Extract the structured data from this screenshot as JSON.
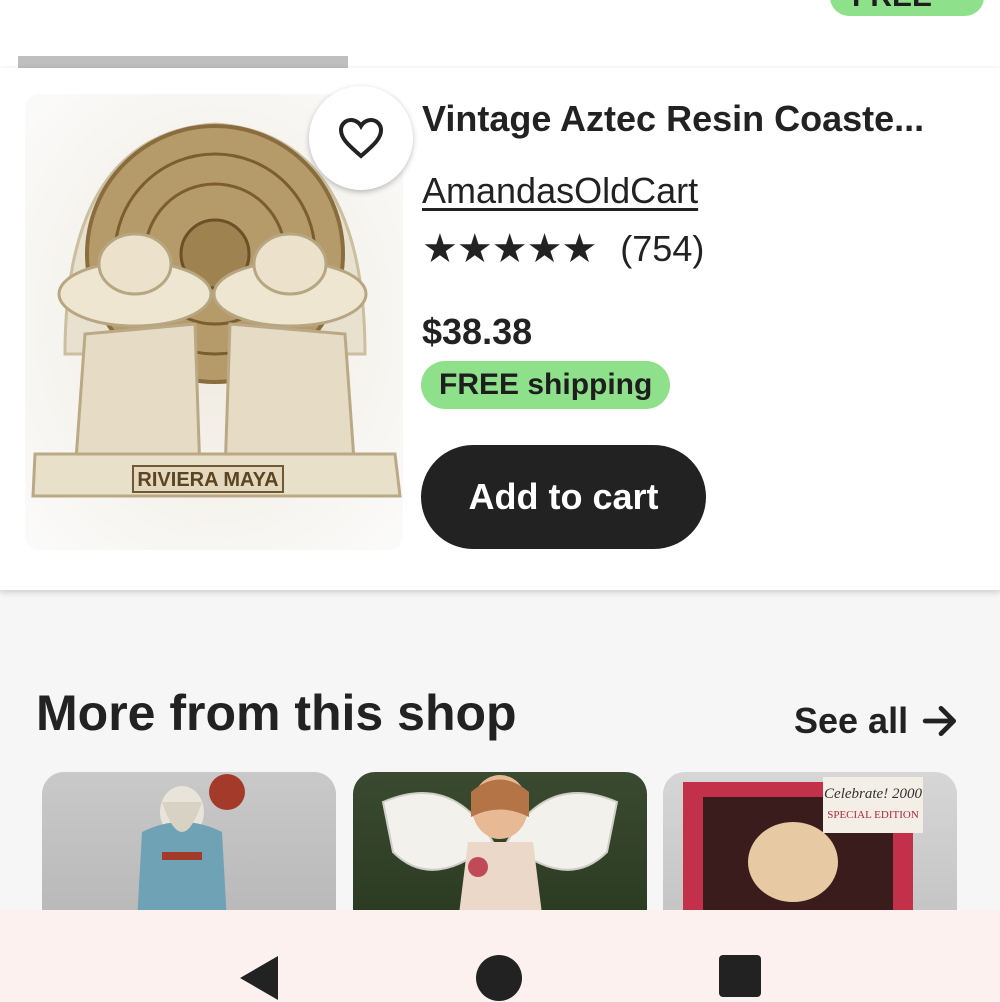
{
  "top": {
    "free_chip": "FREE shi"
  },
  "product": {
    "title": "Vintage Aztec Resin Coaste...",
    "shop": "AmandasOldCart",
    "stars": "★★★★★",
    "review_count": "(754)",
    "rating": 5,
    "price": "$38.38",
    "shipping": "FREE shipping",
    "add_to_cart": "Add to cart",
    "image_caption": "RIVIERA MAYA"
  },
  "more": {
    "title": "More from this shop",
    "see_all": "See all",
    "thumbnails": [
      {
        "alt": "figurine"
      },
      {
        "alt": "angel ornament"
      },
      {
        "alt": "boxed ornament",
        "box_text": "Celebrate! 2000",
        "box_subtext": "SPECIAL EDITION"
      }
    ]
  },
  "colors": {
    "accent_green": "#8fe08a",
    "button_dark": "#222222"
  }
}
